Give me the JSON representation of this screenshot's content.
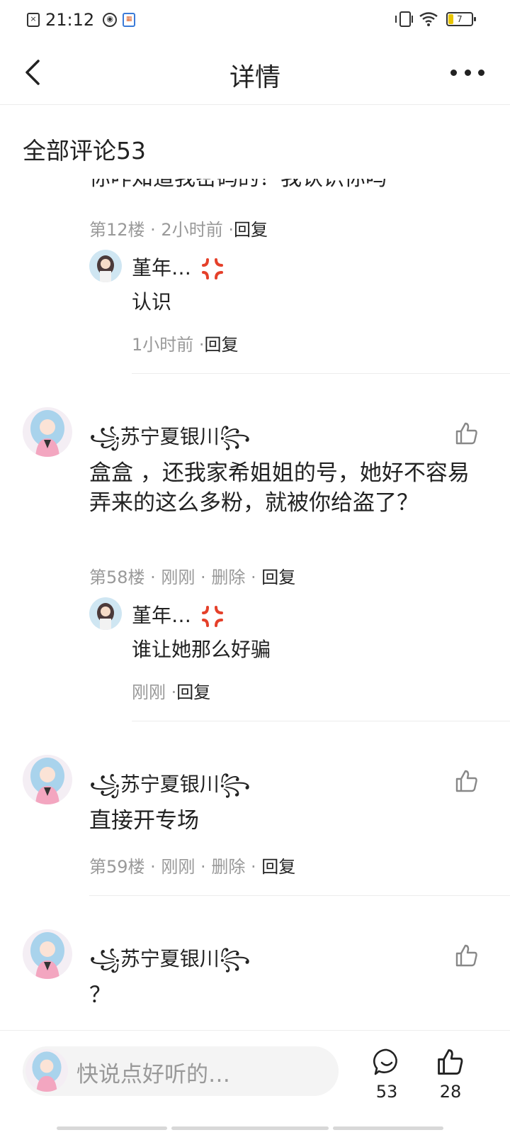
{
  "status_bar": {
    "time": "21:12",
    "battery": "7"
  },
  "header": {
    "title": "详情"
  },
  "comments_header": {
    "label": "全部评论53"
  },
  "cut_text": "你咋知道我密码的？我认识你吗",
  "comment1": {
    "meta_info": "第12楼 · 2小时前 ·",
    "reply_label": "回复",
    "reply": {
      "username": "堇年…",
      "text": "认识",
      "meta_info": "1小时前 ·",
      "reply_label": "回复"
    }
  },
  "comment2": {
    "username": "꧁苏宁夏银川꧂",
    "text": "盒盒 ，还我家希姐姐的号，她好不容易弄来的这么多粉，就被你给盗了？",
    "meta_floor": "第58楼 · 刚刚 ·",
    "delete_label": "删除",
    "sep": " · ",
    "reply_label": "回复",
    "reply": {
      "username": "堇年…",
      "text": "谁让她那么好骗",
      "meta_info": "刚刚 ·",
      "reply_label": "回复"
    }
  },
  "comment3": {
    "username": "꧁苏宁夏银川꧂",
    "text": "直接开专场",
    "meta_floor": "第59楼 · 刚刚 ·",
    "delete_label": "删除",
    "sep": " · ",
    "reply_label": "回复"
  },
  "comment4": {
    "username": "꧁苏宁夏银川꧂",
    "text": "？"
  },
  "bottom_bar": {
    "input_placeholder": "快说点好听的…",
    "comment_count": "53",
    "like_count": "28"
  },
  "colors": {
    "accent_angry": "#e5402a",
    "meta_gray": "#999999"
  }
}
